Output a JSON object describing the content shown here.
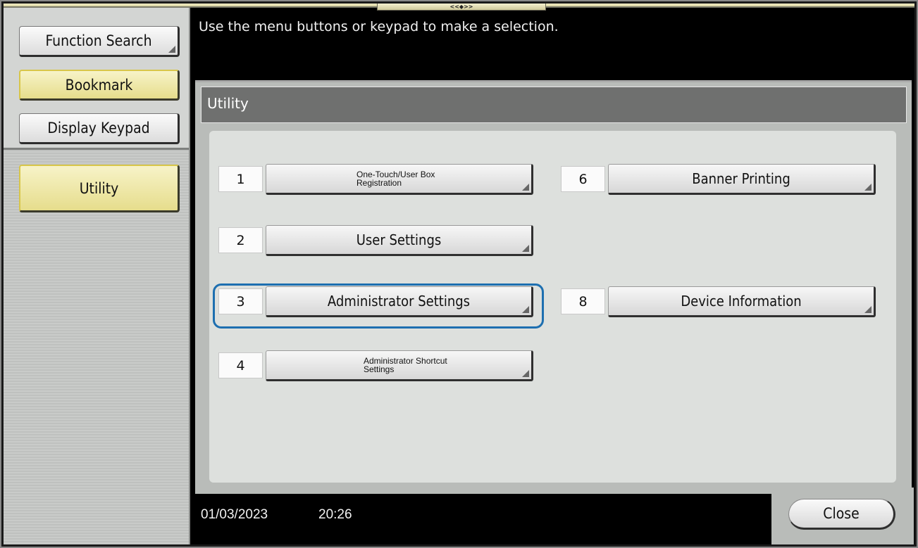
{
  "header": {
    "drag_handle_glyph": "<<◆>>",
    "message": "Use the menu buttons or keypad to make a selection."
  },
  "sidebar": {
    "function_search": "Function Search",
    "bookmark": "Bookmark",
    "display_keypad": "Display Keypad",
    "utility": "Utility"
  },
  "utility": {
    "title": "Utility",
    "items": [
      {
        "number": "1",
        "label_line1": "One-Touch/User Box",
        "label_line2": "Registration"
      },
      {
        "number": "2",
        "label": "User Settings"
      },
      {
        "number": "3",
        "label": "Administrator Settings",
        "selected": true
      },
      {
        "number": "4",
        "label_line1": "Administrator Shortcut",
        "label_line2": "Settings"
      },
      {
        "number": "6",
        "label": "Banner Printing"
      },
      {
        "number": "8",
        "label": "Device Information"
      }
    ]
  },
  "footer": {
    "date": "01/03/2023",
    "time": "20:26",
    "close_label": "Close"
  },
  "colors": {
    "highlight": "#1d6fb0",
    "yellow_button": "#e6dd8c",
    "header_bar": "#6f706f"
  }
}
